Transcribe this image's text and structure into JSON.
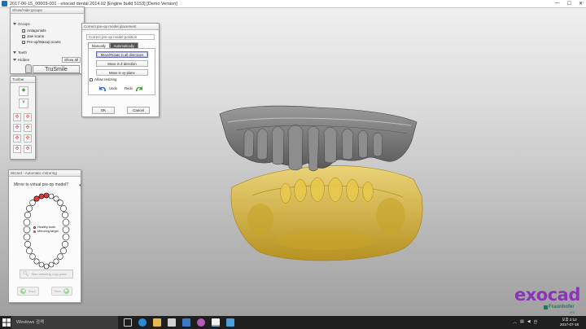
{
  "window": {
    "title": "2017-06-15_00003-001 - exocad dental 2014.02 [Engine build 5153] [Demo Version]",
    "minimize": "—",
    "maximize": "☐",
    "close": "✕"
  },
  "show_hide": {
    "title": "Show/Hide groups",
    "groups_label": "Groups",
    "items": [
      {
        "label": "Antagonists",
        "checked": true
      },
      {
        "label": "Jaw scans",
        "checked": true
      },
      {
        "label": "Pre-op/Waxup scans",
        "checked": true
      }
    ],
    "teeth_label": "Teeth",
    "hidden_label": "Hidden",
    "show_all": "Show all",
    "trusmile": "TruSmile"
  },
  "toolbar": {
    "title": "Toolbar"
  },
  "wizard": {
    "title": "Wizard - Automatic mirroring",
    "question": "Mirror to virtual pre-op model?",
    "legend": [
      {
        "label": "Healthy tooth",
        "color": "#ffffff"
      },
      {
        "label": "Mirroring target",
        "color": "#e23b3b"
      }
    ],
    "start_button": "Start mirroring copy-paste",
    "back": "Back",
    "next": "Next"
  },
  "preop": {
    "title": "Correct pre-op model placement",
    "field": "Correct pre-op model position",
    "tabs": [
      "Manually",
      "Automatically"
    ],
    "options": [
      "Move/Rotate in all directions",
      "Move in Z direction",
      "Move in xy-plane"
    ],
    "allow_resizing": "Allow resizing",
    "undo": "Undo",
    "redo": "Redo",
    "ok": "OK",
    "cancel": "Cancel"
  },
  "logo": {
    "brand": "exocad",
    "partner": "Fraunhofer",
    "partner_sub": "IGD"
  },
  "taskbar": {
    "search": "Windows 검색",
    "time": "오후 2:12",
    "date": "2017-07-18",
    "tray_lang": "한"
  },
  "colors": {
    "upper_model": "#7a7a7a",
    "lower_model": "#d9b42a",
    "brand": "#8a35b8",
    "partner": "#1a7a5e"
  }
}
